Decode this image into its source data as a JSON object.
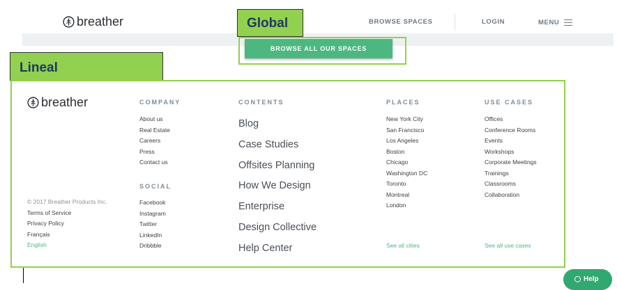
{
  "header": {
    "logo_text": "breather",
    "nav": {
      "browse": "BROWSE SPACES",
      "login": "LOGIN",
      "menu": "MENU"
    },
    "menu_icon": "hamburger-icon"
  },
  "annotations": {
    "global": "Global",
    "lineal": "Lineal",
    "annotation_color": "#92d050"
  },
  "cta": {
    "label": "BROWSE ALL OUR SPACES",
    "color": "#4cb87f"
  },
  "footer": {
    "logo_text": "breather",
    "legal": {
      "copyright": "© 2017 Breather Products Inc.",
      "links": [
        "Terms of Service",
        "Privacy Policy",
        "Français"
      ],
      "language": "English"
    },
    "company": {
      "heading": "COMPANY",
      "links": [
        "About us",
        "Real Estate",
        "Careers",
        "Press",
        "Contact us"
      ]
    },
    "social": {
      "heading": "SOCIAL",
      "links": [
        "Facebook",
        "Instagram",
        "Twitter",
        "LinkedIn",
        "Dribbble"
      ]
    },
    "contents": {
      "heading": "CONTENTS",
      "links": [
        "Blog",
        "Case Studies",
        "Offsites Planning",
        "How We Design",
        "Enterprise",
        "Design Collective",
        "Help Center"
      ]
    },
    "places": {
      "heading": "PLACES",
      "links": [
        "New York City",
        "San Francisco",
        "Los Angeles",
        "Boston",
        "Chicago",
        "Washington DC",
        "Toronto",
        "Montreal",
        "London"
      ],
      "see_all": "See all cities"
    },
    "use_cases": {
      "heading": "USE CASES",
      "links": [
        "Offices",
        "Conference Rooms",
        "Events",
        "Workshops",
        "Corporate Meetings",
        "Trainings",
        "Classrooms",
        "Collaboration"
      ],
      "see_all": "See all use cases"
    }
  },
  "help": {
    "label": "Help",
    "icon": "chat-bubble-icon"
  }
}
